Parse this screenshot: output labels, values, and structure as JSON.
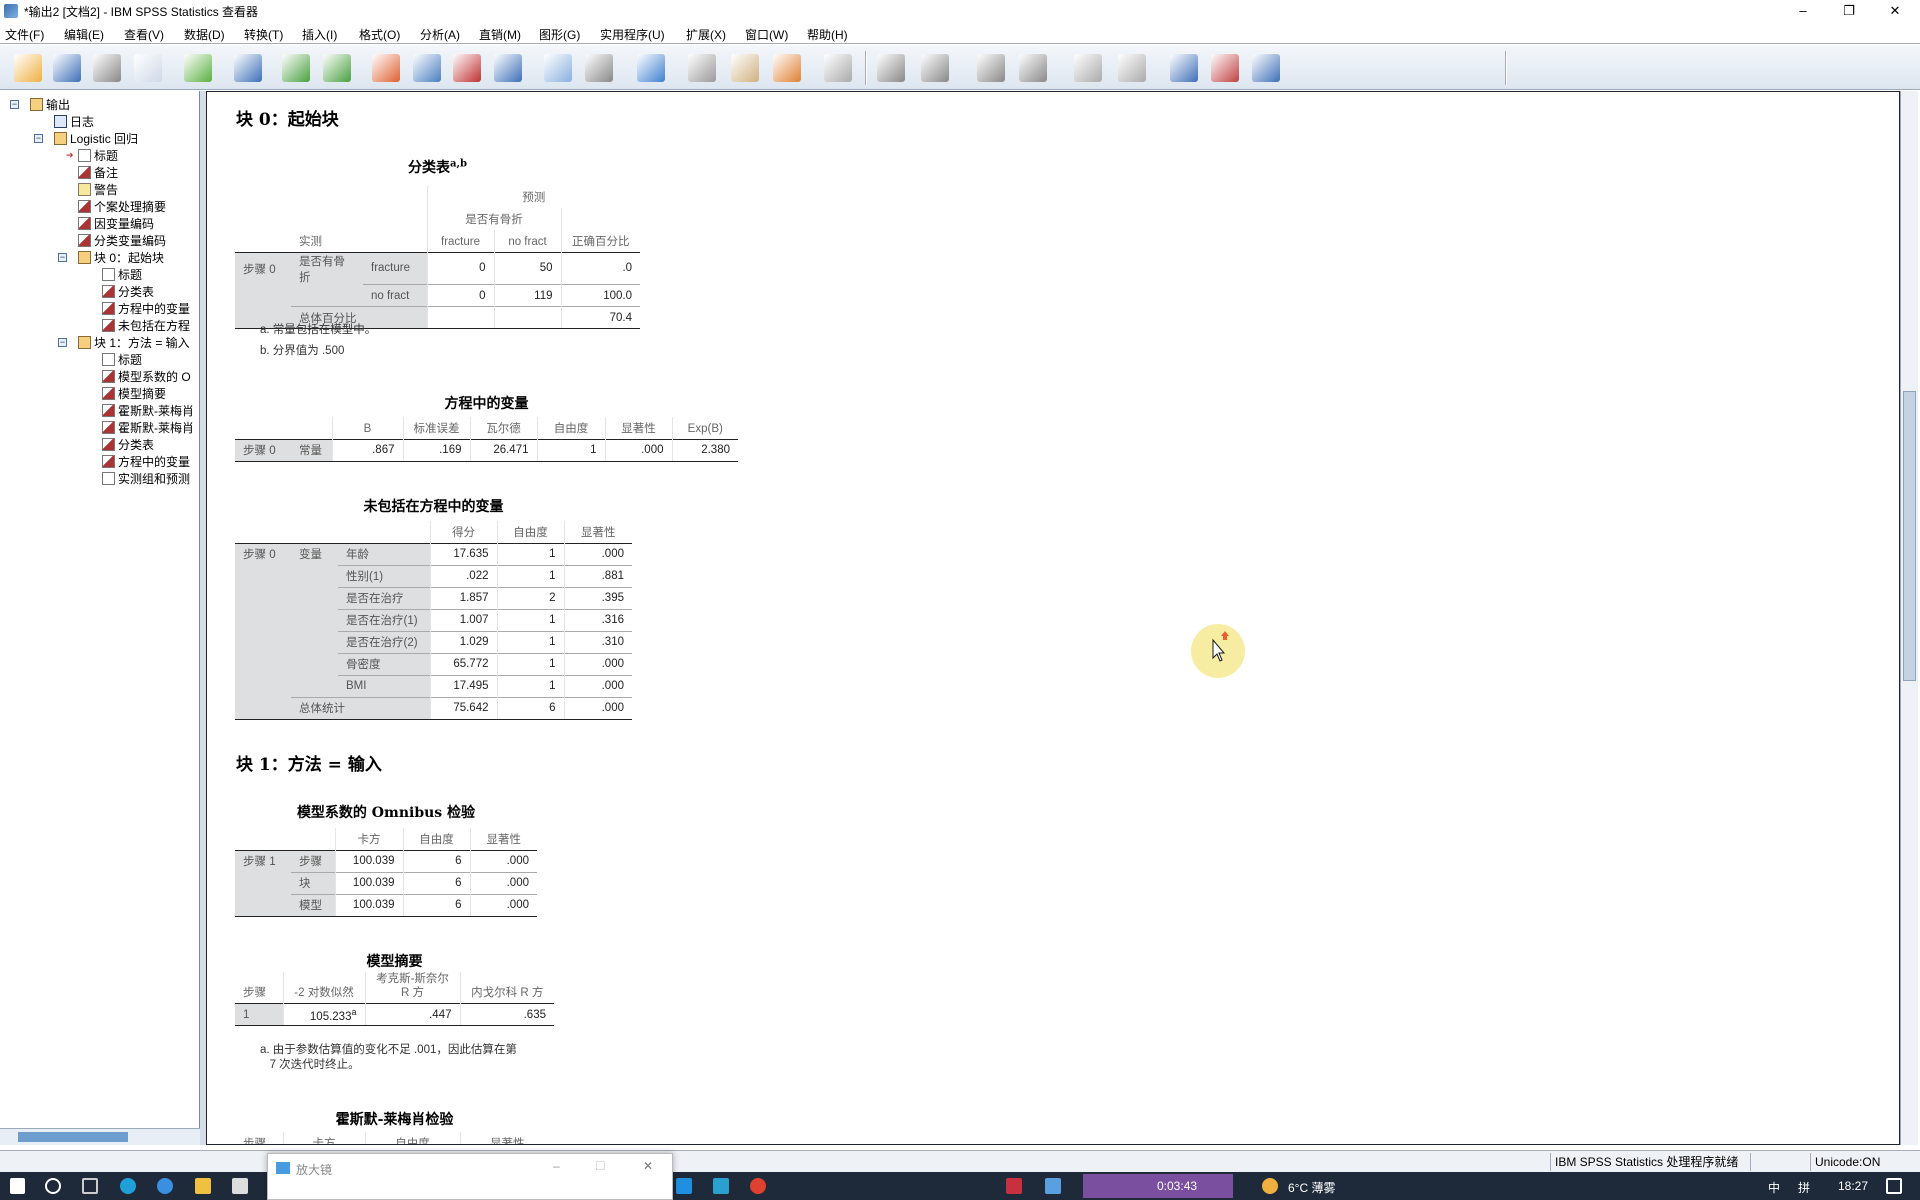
{
  "window": {
    "title": "*输出2 [文档2] - IBM SPSS Statistics 查看器",
    "minimize": "–",
    "restore": "❐",
    "close": "✕"
  },
  "menu": [
    "文件(F)",
    "编辑(E)",
    "查看(V)",
    "数据(D)",
    "转换(T)",
    "插入(I)",
    "格式(O)",
    "分析(A)",
    "直销(M)",
    "图形(G)",
    "实用程序(U)",
    "扩展(X)",
    "窗口(W)",
    "帮助(H)"
  ],
  "toolbar": [
    "open-icon",
    "save-icon",
    "print-icon",
    "print-preview-icon",
    "export-icon",
    "recall-dialog-icon",
    "undo-icon",
    "redo-icon",
    "goto-case-icon",
    "goto-variable-icon",
    "insert-output-icon",
    "variables-icon",
    "show-all-icon",
    "hide-icon",
    "outline-icon",
    "promote-icon",
    "insert-heading-icon",
    "insert-text-icon",
    "designate-window-icon",
    "back-icon",
    "forward-icon",
    "expand-icon",
    "collapse-icon",
    "show-icon",
    "hide-item-icon",
    "insert-title-icon",
    "insert-page-title-icon",
    "insert-new-text-icon"
  ],
  "tree": [
    {
      "label": "输出",
      "level": 0,
      "icon": "book",
      "exp": "−"
    },
    {
      "label": "日志",
      "level": 1,
      "icon": "log"
    },
    {
      "label": "Logistic 回归",
      "level": 1,
      "icon": "book",
      "exp": "−"
    },
    {
      "label": "标题",
      "level": 2,
      "icon": "text",
      "selected": true
    },
    {
      "label": "备注",
      "level": 2,
      "icon": "table"
    },
    {
      "label": "警告",
      "level": 2,
      "icon": "warn"
    },
    {
      "label": "个案处理摘要",
      "level": 2,
      "icon": "table"
    },
    {
      "label": "因变量编码",
      "level": 2,
      "icon": "table"
    },
    {
      "label": "分类变量编码",
      "level": 2,
      "icon": "table"
    },
    {
      "label": "块 0：起始块",
      "level": 2,
      "icon": "book",
      "exp": "−"
    },
    {
      "label": "标题",
      "level": 3,
      "icon": "text"
    },
    {
      "label": "分类表",
      "level": 3,
      "icon": "table"
    },
    {
      "label": "方程中的变量",
      "level": 3,
      "icon": "table"
    },
    {
      "label": "未包括在方程",
      "level": 3,
      "icon": "table"
    },
    {
      "label": "块 1：方法 = 输入",
      "level": 2,
      "icon": "book",
      "exp": "−"
    },
    {
      "label": "标题",
      "level": 3,
      "icon": "text"
    },
    {
      "label": "模型系数的 O",
      "level": 3,
      "icon": "table"
    },
    {
      "label": "模型摘要",
      "level": 3,
      "icon": "table"
    },
    {
      "label": "霍斯默-莱梅肖",
      "level": 3,
      "icon": "table"
    },
    {
      "label": "霍斯默-莱梅肖",
      "level": 3,
      "icon": "table"
    },
    {
      "label": "分类表",
      "level": 3,
      "icon": "table"
    },
    {
      "label": "方程中的变量",
      "level": 3,
      "icon": "table"
    },
    {
      "label": "实测组和预测",
      "level": 3,
      "icon": "text"
    }
  ],
  "content": {
    "block0_heading": "块 0：起始块",
    "block1_heading": "块 1：方法 = 输入",
    "tables": [
      {
        "title": "分类表",
        "sup": "a,b",
        "header_rows": [
          [
            {
              "t": "",
              "span": 3
            },
            {
              "t": "预测",
              "span": 3
            }
          ],
          [
            {
              "t": "",
              "span": 3
            },
            {
              "t": "是否有骨折",
              "span": 2
            },
            {
              "t": ""
            }
          ],
          [
            {
              "t": ""
            },
            {
              "t": "实测",
              "span": 2
            },
            {
              "t": "fracture"
            },
            {
              "t": "no fract"
            },
            {
              "t": "正确百分比"
            }
          ]
        ],
        "rows": [
          {
            "stub": [
              "步骤 0",
              "是否有骨折",
              "fracture"
            ],
            "values": [
              "0",
              "50",
              ".0"
            ]
          },
          {
            "stub": [
              "",
              "",
              "no fract"
            ],
            "values": [
              "0",
              "119",
              "100.0"
            ]
          },
          {
            "stub": [
              "",
              {
                "t": "总体百分比",
                "span": 2
              }
            ],
            "values": [
              "",
              "",
              "70.4"
            ]
          }
        ],
        "footnotes": [
          "a. 常量包括在模型中。",
          "b. 分界值为 .500"
        ]
      },
      {
        "title": "方程中的变量",
        "header_rows": [
          [
            {
              "t": "",
              "span": 2
            },
            {
              "t": "B"
            },
            {
              "t": "标准误差"
            },
            {
              "t": "瓦尔德"
            },
            {
              "t": "自由度"
            },
            {
              "t": "显著性"
            },
            {
              "t": "Exp(B)"
            }
          ]
        ],
        "rows": [
          {
            "stub": [
              "步骤 0",
              "常量"
            ],
            "values": [
              ".867",
              ".169",
              "26.471",
              "1",
              ".000",
              "2.380"
            ]
          }
        ]
      },
      {
        "title": "未包括在方程中的变量",
        "header_rows": [
          [
            {
              "t": "",
              "span": 3
            },
            {
              "t": "得分"
            },
            {
              "t": "自由度"
            },
            {
              "t": "显著性"
            }
          ]
        ],
        "rows": [
          {
            "stub": [
              "步骤 0",
              "变量",
              "年龄"
            ],
            "values": [
              "17.635",
              "1",
              ".000"
            ]
          },
          {
            "stub": [
              "",
              "",
              "性别(1)"
            ],
            "values": [
              ".022",
              "1",
              ".881"
            ]
          },
          {
            "stub": [
              "",
              "",
              "是否在治疗"
            ],
            "values": [
              "1.857",
              "2",
              ".395"
            ]
          },
          {
            "stub": [
              "",
              "",
              "是否在治疗(1)"
            ],
            "values": [
              "1.007",
              "1",
              ".316"
            ]
          },
          {
            "stub": [
              "",
              "",
              "是否在治疗(2)"
            ],
            "values": [
              "1.029",
              "1",
              ".310"
            ]
          },
          {
            "stub": [
              "",
              "",
              "骨密度"
            ],
            "values": [
              "65.772",
              "1",
              ".000"
            ]
          },
          {
            "stub": [
              "",
              "",
              "BMI"
            ],
            "values": [
              "17.495",
              "1",
              ".000"
            ]
          },
          {
            "stub": [
              "",
              {
                "t": "总体统计",
                "span": 2
              }
            ],
            "values": [
              "75.642",
              "6",
              ".000"
            ]
          }
        ]
      },
      {
        "title": "模型系数的 Omnibus 检验",
        "header_rows": [
          [
            {
              "t": "",
              "span": 2
            },
            {
              "t": "卡方"
            },
            {
              "t": "自由度"
            },
            {
              "t": "显著性"
            }
          ]
        ],
        "rows": [
          {
            "stub": [
              "步骤 1",
              "步骤"
            ],
            "values": [
              "100.039",
              "6",
              ".000"
            ]
          },
          {
            "stub": [
              "",
              "块"
            ],
            "values": [
              "100.039",
              "6",
              ".000"
            ]
          },
          {
            "stub": [
              "",
              "模型"
            ],
            "values": [
              "100.039",
              "6",
              ".000"
            ]
          }
        ]
      },
      {
        "title": "模型摘要",
        "header_rows": [
          [
            {
              "t": "步骤"
            },
            {
              "t": "-2 对数似然"
            },
            {
              "t": "考克斯-斯奈尔\nR 方"
            },
            {
              "t": "内戈尔科 R 方"
            }
          ]
        ],
        "rows": [
          {
            "stub": [
              "1"
            ],
            "values": [
              {
                "v": "105.233",
                "sup": "a"
              },
              ".447",
              ".635"
            ]
          }
        ],
        "footnotes": [
          "a. 由于参数估算值的变化不足 .001，因此估算在第\n   7 次迭代时终止。"
        ]
      },
      {
        "title": "霍斯默-莱梅肖检验",
        "header_rows": [
          [
            {
              "t": "步骤"
            },
            {
              "t": "卡方"
            },
            {
              "t": "自由度"
            },
            {
              "t": "显著性"
            }
          ]
        ],
        "rows": []
      }
    ]
  },
  "status": {
    "message": "IBM SPSS Statistics 处理程序就绪",
    "unicode": "Unicode:ON"
  },
  "magnifier": {
    "title": "放大镜",
    "minimize": "–",
    "maximize": "☐",
    "close": "✕"
  },
  "taskbar": {
    "recorder_time": "0:03:43",
    "weather": "6°C 薄雾",
    "ime": "中",
    "ime2": "拼",
    "clock": "18:27"
  },
  "colors": {
    "accent": "#1e2a3a",
    "stub_bg": "#dedfe0",
    "cursor_highlight": "#f6ec9a"
  }
}
